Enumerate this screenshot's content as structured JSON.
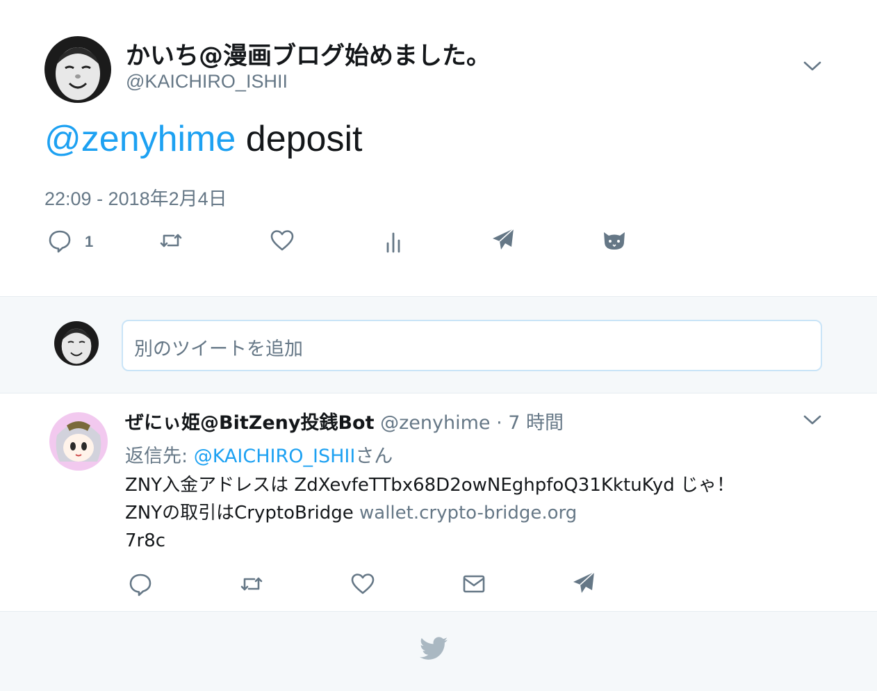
{
  "main_tweet": {
    "display_name": "かいち@漫画ブログ始めました。",
    "handle": "@KAICHIRO_ISHII",
    "mention": "@zenyhime",
    "text": " deposit",
    "timestamp": "22:09 - 2018年2月4日",
    "reply_count": "1",
    "actions": [
      "reply-icon",
      "retweet-icon",
      "heart-icon",
      "analytics-icon",
      "send-dm-icon",
      "cat-icon"
    ]
  },
  "reply_box": {
    "placeholder": "別のツイートを追加"
  },
  "reply_tweet": {
    "display_name": "ぜにぃ姫@BitZeny投銭Bot",
    "handle": "@zenyhime",
    "separator": " · ",
    "time": "7 時間",
    "reply_to_prefix": "返信先: ",
    "reply_to_user": "@KAICHIRO_ISHII",
    "reply_to_suffix": "さん",
    "line1": "ZNY入金アドレスは ZdXevfeTTbx68D2owNEghpfoQ31KktuKyd じゃ！",
    "line2_prefix": "ZNYの取引はCryptoBridge ",
    "line2_link": "wallet.crypto-bridge.org",
    "line3": "7r8c",
    "actions": [
      "reply-icon",
      "retweet-icon",
      "heart-icon",
      "mail-icon",
      "send-dm-icon"
    ]
  },
  "footer": {
    "icon": "twitter-bird-icon"
  },
  "colors": {
    "link": "#1da1f2",
    "muted": "#657786",
    "text": "#14171a",
    "footer_bg": "#f5f8fa"
  }
}
